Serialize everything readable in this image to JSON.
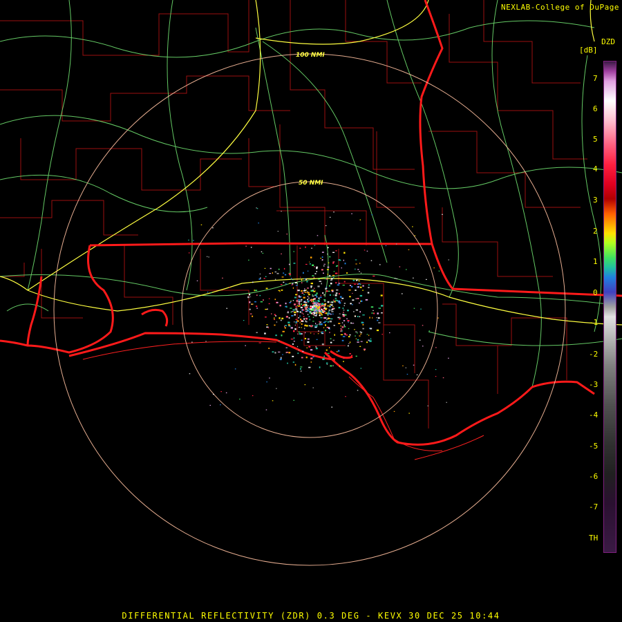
{
  "credit": "NEXLAB-College of DuPage",
  "product": "DZD",
  "unit": "[dB]",
  "colorbar_ticks": [
    "7",
    "6",
    "5",
    "4",
    "3",
    "2",
    "1",
    "0",
    "-1",
    "-2",
    "-3",
    "-4",
    "-5",
    "-6",
    "-7",
    "TH"
  ],
  "range_rings": [
    "100 NMI",
    "50 NMI"
  ],
  "status": "DIFFERENTIAL REFLECTIVITY (ZDR) 0.3 DEG - KEVX 30 DEC 25 10:44",
  "colors": {
    "state_border": "#ff1a1a",
    "county_line": "#c01010",
    "highway": "#ffff40",
    "road": "#70e070",
    "ring": "#ffc0a0",
    "text": "#ffff00"
  }
}
